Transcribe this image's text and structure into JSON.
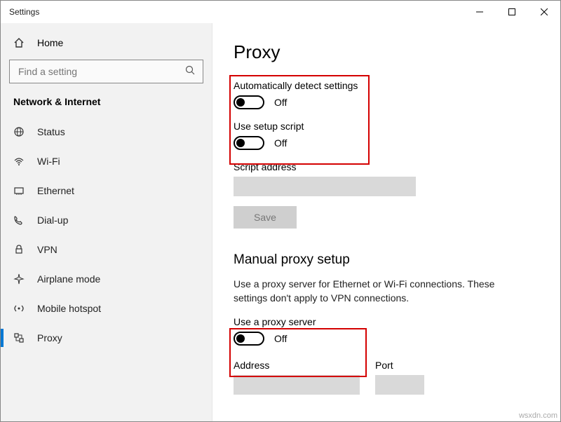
{
  "window": {
    "title": "Settings"
  },
  "sidebar": {
    "home_label": "Home",
    "search_placeholder": "Find a setting",
    "category": "Network & Internet",
    "items": [
      {
        "label": "Status",
        "icon": "globe-icon",
        "selected": false
      },
      {
        "label": "Wi-Fi",
        "icon": "wifi-icon",
        "selected": false
      },
      {
        "label": "Ethernet",
        "icon": "ethernet-icon",
        "selected": false
      },
      {
        "label": "Dial-up",
        "icon": "dialup-icon",
        "selected": false
      },
      {
        "label": "VPN",
        "icon": "vpn-icon",
        "selected": false
      },
      {
        "label": "Airplane mode",
        "icon": "airplane-icon",
        "selected": false
      },
      {
        "label": "Mobile hotspot",
        "icon": "hotspot-icon",
        "selected": false
      },
      {
        "label": "Proxy",
        "icon": "proxy-icon",
        "selected": true
      }
    ]
  },
  "page": {
    "title": "Proxy",
    "auto_detect": {
      "label": "Automatically detect settings",
      "state": "Off",
      "on": false
    },
    "setup_script": {
      "label": "Use setup script",
      "state": "Off",
      "on": false
    },
    "script_address_label": "Script address",
    "save_label": "Save",
    "manual_header": "Manual proxy setup",
    "manual_desc": "Use a proxy server for Ethernet or Wi-Fi connections. These settings don't apply to VPN connections.",
    "use_proxy": {
      "label": "Use a proxy server",
      "state": "Off",
      "on": false
    },
    "address_label": "Address",
    "port_label": "Port"
  },
  "watermark": "wsxdn.com",
  "colors": {
    "accent": "#0078d4",
    "highlight": "#d40000"
  }
}
